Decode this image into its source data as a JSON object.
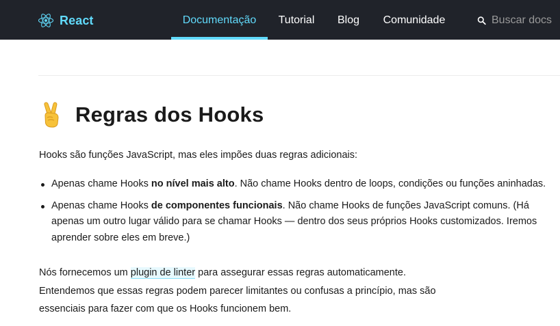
{
  "header": {
    "brand": "React",
    "nav": [
      "Documentação",
      "Tutorial",
      "Blog",
      "Comunidade"
    ],
    "active_nav": "Documentação",
    "search_placeholder": "Buscar docs"
  },
  "article": {
    "title": "Regras dos Hooks",
    "intro": "Hooks são funções JavaScript, mas eles impões duas regras adicionais:",
    "rules": [
      {
        "lead": "Apenas chame Hooks ",
        "bold": "no nível mais alto",
        "rest": ". Não chame Hooks dentro de loops, condições ou funções aninhadas."
      },
      {
        "lead": "Apenas chame Hooks ",
        "bold": "de componentes funcionais",
        "rest": ". Não chame Hooks de funções JavaScript comuns. (Há apenas um outro lugar válido para se chamar Hooks — dentro dos seus próprios Hooks customizados. Iremos aprender sobre eles em breve.)"
      }
    ],
    "closing": {
      "before_link": "Nós fornecemos um ",
      "link": "plugin de linter",
      "after_link": " para assegurar essas regras automaticamente.",
      "line2": "Entendemos que essas regras podem parecer limitantes ou confusas a princípio, mas são",
      "line3": "essenciais para fazer com que os Hooks funcionem bem."
    }
  },
  "colors": {
    "nav_background": "#20232a",
    "accent": "#61dafb",
    "text": "#1a1a1a"
  },
  "icons": {
    "brand_logo": "react-atom-icon",
    "search": "search-icon",
    "title_emoji": "victory-hand-icon"
  }
}
